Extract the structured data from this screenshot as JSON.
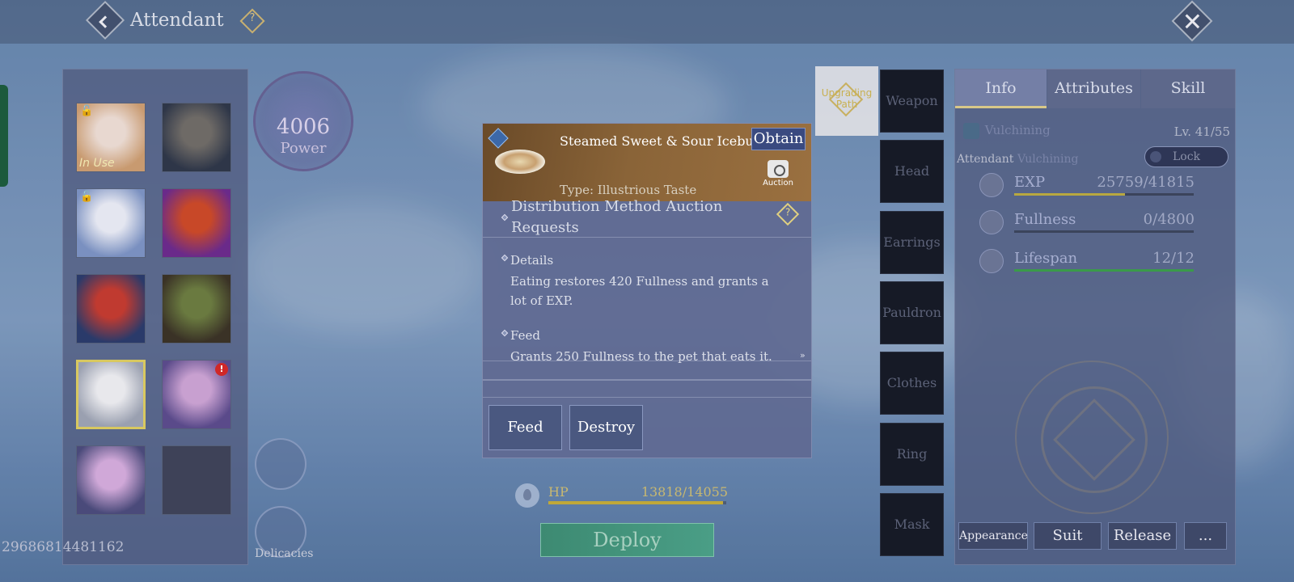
{
  "header": {
    "title": "Attendant",
    "help_glyph": "?",
    "icons": {
      "back": "back-diamond-icon",
      "help": "help-diamond-icon",
      "close": "close-x-icon"
    }
  },
  "roster": {
    "id_number": "29686814481162",
    "in_use_label": "In Use",
    "lock_glyph": "🔓",
    "alert_glyph": "!",
    "slots": [
      {
        "name": "white-haired-woman",
        "colors": [
          "#e8d8d0",
          "#c89a70"
        ],
        "locked": true,
        "in_use": true,
        "selected": false,
        "alert": false,
        "empty": false
      },
      {
        "name": "grey-cat",
        "colors": [
          "#6e6a66",
          "#2e3648"
        ],
        "locked": false,
        "in_use": false,
        "selected": false,
        "alert": false,
        "empty": false
      },
      {
        "name": "white-haired-girl",
        "colors": [
          "#e4e6f0",
          "#7a90c0"
        ],
        "locked": true,
        "in_use": false,
        "selected": false,
        "alert": false,
        "empty": false
      },
      {
        "name": "red-haired-woman",
        "colors": [
          "#c84828",
          "#6a2a8a"
        ],
        "locked": false,
        "in_use": false,
        "selected": false,
        "alert": false,
        "empty": false
      },
      {
        "name": "red-haired-child",
        "colors": [
          "#c03a30",
          "#2a3a6a"
        ],
        "locked": false,
        "in_use": false,
        "selected": false,
        "alert": false,
        "empty": false
      },
      {
        "name": "green-goblin",
        "colors": [
          "#6a7a40",
          "#3a3226"
        ],
        "locked": false,
        "in_use": false,
        "selected": false,
        "alert": false,
        "empty": false
      },
      {
        "name": "white-fox",
        "colors": [
          "#e8e8ec",
          "#9aa0b0"
        ],
        "locked": false,
        "in_use": false,
        "selected": true,
        "alert": false,
        "empty": false
      },
      {
        "name": "purple-haired-girl",
        "colors": [
          "#c8a0d0",
          "#5a4a8a"
        ],
        "locked": false,
        "in_use": false,
        "selected": false,
        "alert": true,
        "empty": false
      },
      {
        "name": "purple-haired-girl-2",
        "colors": [
          "#d0a8d8",
          "#4a4a7a"
        ],
        "locked": false,
        "in_use": false,
        "selected": false,
        "alert": false,
        "empty": false
      },
      {
        "name": "empty-slot",
        "colors": [
          "#3e4258",
          "#3e4258"
        ],
        "locked": false,
        "in_use": false,
        "selected": false,
        "alert": false,
        "empty": true
      }
    ]
  },
  "power": {
    "value": "4006",
    "label": "Power"
  },
  "side_buttons": {
    "feed_icon": "food-bowl-icon",
    "delicacies_icon": "delicacies-icon",
    "delicacies_label": "Delicacies"
  },
  "item": {
    "name": "Steamed Sweet & Sour Icebug",
    "obtain_label": "Obtain",
    "type_text": "Type: Illustrious Taste",
    "auction_label": "Auction",
    "distribution_line1": "Distribution Method    Auction",
    "distribution_line2": "Requests",
    "details_title": "Details",
    "details_text": "Eating restores 420 Fullness and grants a lot of EXP.",
    "feed_title": "Feed",
    "feed_text": "Grants 250 Fullness to the pet that eats it.",
    "scroll_glyph": "»",
    "feed_button": "Feed",
    "destroy_button": "Destroy"
  },
  "hp": {
    "label": "HP",
    "value": "13818/14055",
    "fraction": 0.983
  },
  "deploy_label": "Deploy",
  "equipment": {
    "upgrade_label": "Upgrading Path",
    "slots": [
      "Weapon",
      "Head",
      "Earrings",
      "Pauldron",
      "Clothes",
      "Ring",
      "Mask"
    ]
  },
  "info_panel": {
    "tabs": [
      "Info",
      "Attributes",
      "Skill"
    ],
    "active_tab": 0,
    "pet_name": "Vulchining",
    "level": "Lv. 41/55",
    "attendant_label": "Attendant",
    "attendant_name": "Vulchining",
    "lock_label": "Lock",
    "stats": [
      {
        "name": "EXP",
        "value": "25759/41815",
        "fraction": 0.616,
        "color": "#b8a840",
        "icon": "exp-icon"
      },
      {
        "name": "Fullness",
        "value": "0/4800",
        "fraction": 0.0,
        "color": "#8a90a8",
        "icon": "fullness-icon"
      },
      {
        "name": "Lifespan",
        "value": "12/12",
        "fraction": 1.0,
        "color": "#3a9a4a",
        "icon": "heart-icon"
      }
    ],
    "buttons": [
      "Appearance",
      "Suit",
      "Release",
      "..."
    ]
  }
}
